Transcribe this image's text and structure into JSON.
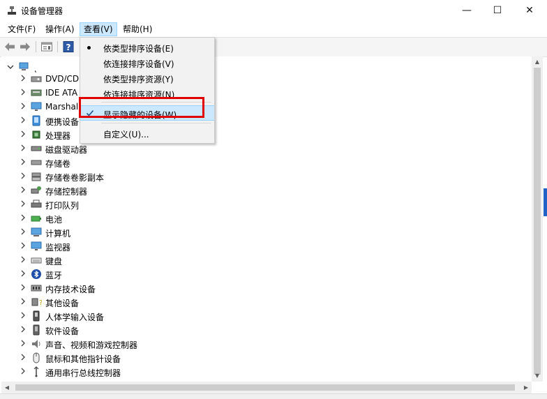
{
  "window": {
    "title": "设备管理器",
    "minimize": "—",
    "maximize": "☐",
    "close": "✕"
  },
  "menubar": {
    "items": [
      {
        "label": "文件(F)"
      },
      {
        "label": "操作(A)"
      },
      {
        "label": "查看(V)"
      },
      {
        "label": "帮助(H)"
      }
    ],
    "active": "查看(V)"
  },
  "toolbar": {
    "buttons": [
      "back-arrow-icon",
      "forward-arrow-icon",
      "properties-icon",
      "help-icon"
    ]
  },
  "view_menu": {
    "items": [
      {
        "label": "依类型排序设备(E)",
        "state": "bullet"
      },
      {
        "label": "依连接排序设备(V)",
        "state": ""
      },
      {
        "label": "依类型排序资源(Y)",
        "state": ""
      },
      {
        "label": "依连接排序资源(N)",
        "state": ""
      },
      {
        "label": "显示隐藏的设备(W)",
        "state": "checked"
      },
      {
        "label": "自定义(U)...",
        "state": ""
      }
    ]
  },
  "tree": {
    "root_label": "˛",
    "items": [
      {
        "label": "DVD/CD",
        "icon": "dvd-drive-icon"
      },
      {
        "label": "IDE ATA",
        "icon": "ide-controller-icon"
      },
      {
        "label": "Marshal",
        "icon": "monitor-icon"
      },
      {
        "label": "便携设备",
        "icon": "portable-device-icon"
      },
      {
        "label": "处理器",
        "icon": "processor-icon"
      },
      {
        "label": "磁盘驱动器",
        "icon": "disk-drive-icon"
      },
      {
        "label": "存储卷",
        "icon": "storage-volume-icon"
      },
      {
        "label": "存储卷卷影副本",
        "icon": "shadow-copy-icon"
      },
      {
        "label": "存储控制器",
        "icon": "storage-controller-icon"
      },
      {
        "label": "打印队列",
        "icon": "printer-icon"
      },
      {
        "label": "电池",
        "icon": "battery-icon"
      },
      {
        "label": "计算机",
        "icon": "computer-icon"
      },
      {
        "label": "监视器",
        "icon": "monitor-icon"
      },
      {
        "label": "键盘",
        "icon": "keyboard-icon"
      },
      {
        "label": "蓝牙",
        "icon": "bluetooth-icon"
      },
      {
        "label": "内存技术设备",
        "icon": "memory-device-icon"
      },
      {
        "label": "其他设备",
        "icon": "other-device-icon"
      },
      {
        "label": "人体学输入设备",
        "icon": "hid-icon"
      },
      {
        "label": "软件设备",
        "icon": "software-device-icon"
      },
      {
        "label": "声音、视频和游戏控制器",
        "icon": "speaker-icon"
      },
      {
        "label": "鼠标和其他指针设备",
        "icon": "mouse-icon"
      },
      {
        "label": "通用串行总线控制器",
        "icon": "usb-icon"
      }
    ]
  },
  "colors": {
    "highlight": "#cce8ff",
    "annotation_box": "#e00000",
    "accent": "#1f63c7"
  }
}
